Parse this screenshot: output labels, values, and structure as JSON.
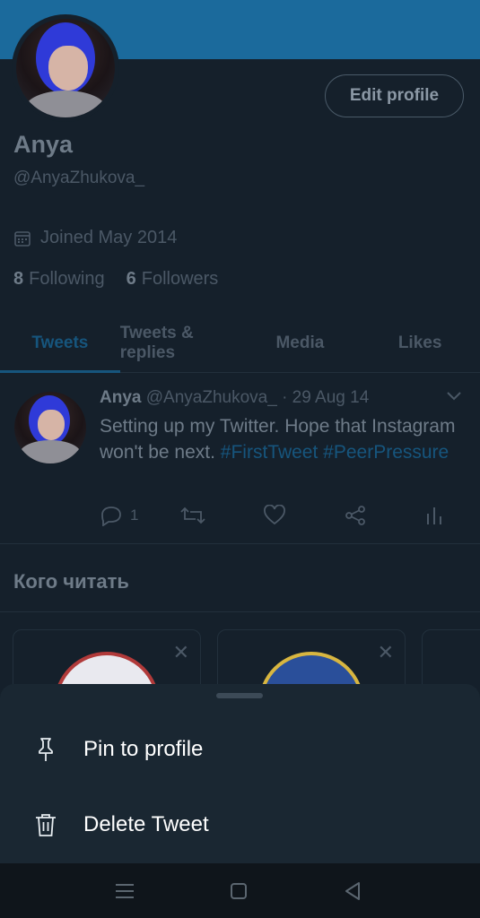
{
  "profile": {
    "name": "Anya",
    "handle": "@AnyaZhukova_",
    "joined": "Joined May 2014",
    "following_count": "8",
    "following_label": "Following",
    "followers_count": "6",
    "followers_label": "Followers",
    "edit_label": "Edit profile"
  },
  "tabs": [
    {
      "label": "Tweets",
      "active": true
    },
    {
      "label": "Tweets & replies"
    },
    {
      "label": "Media"
    },
    {
      "label": "Likes"
    }
  ],
  "tweet": {
    "author": "Anya",
    "handle": "@AnyaZhukova_",
    "date": "· 29 Aug 14",
    "text_plain": "Setting up my Twitter. Hope that Instagram won't be next.",
    "hashtag1": "#FirstTweet",
    "hashtag2": "#PeerPressure",
    "reply_count": "1"
  },
  "who_to_follow": {
    "title": "Кого читать",
    "close_symbol": "✕"
  },
  "sheet": {
    "items": [
      {
        "label": "Pin to profile",
        "icon": "pin-icon"
      },
      {
        "label": "Delete Tweet",
        "icon": "trash-icon"
      }
    ]
  },
  "colors": {
    "background": "#15202b",
    "banner": "#1b6a9c",
    "accent_dim": "#16557d",
    "sheet": "#1a2732",
    "navbar": "#0f151b"
  }
}
